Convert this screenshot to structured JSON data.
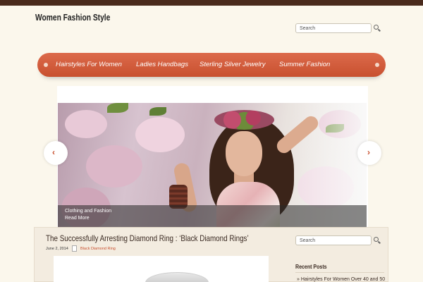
{
  "site": {
    "title": "Women Fashion Style"
  },
  "header": {
    "search_value": "Search"
  },
  "nav": {
    "items": [
      {
        "label": "Hairstyles For Women"
      },
      {
        "label": "Ladies Handbags"
      },
      {
        "label": "Sterling Silver Jewelry"
      },
      {
        "label": "Summer Fashion"
      }
    ]
  },
  "slider": {
    "caption_title": "Clothing and Fashion",
    "read_more": "Read More",
    "prev_glyph": "‹",
    "next_glyph": "›"
  },
  "post": {
    "title": "The Successfully Arresting Diamond Ring : ‘Black Diamond Rings’",
    "date": "June 2, 2014",
    "category": "Black Diamond Ring"
  },
  "sidebar": {
    "search_value": "Search",
    "recent_heading": "Recent Posts",
    "recent_items": [
      "Hairstyles For Women Over 40 and 50"
    ]
  },
  "colors": {
    "accent": "#c8502f",
    "topbar": "#4a2a1c",
    "background": "#fbf7ec"
  }
}
